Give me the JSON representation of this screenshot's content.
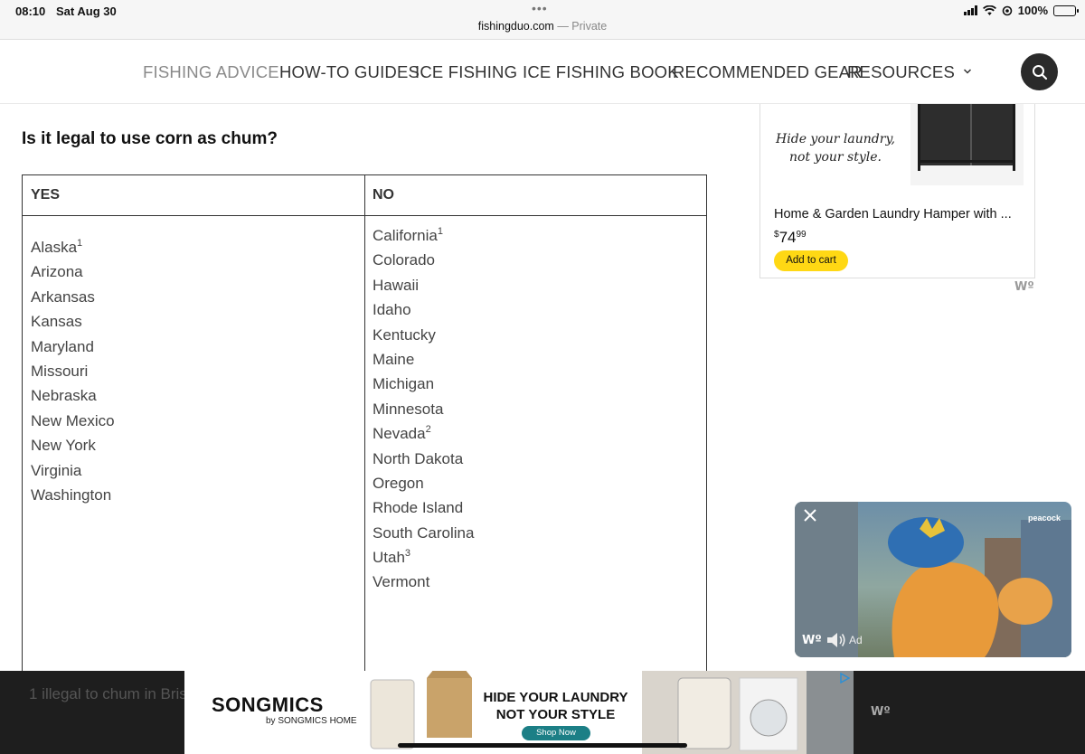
{
  "status_bar": {
    "time": "08:10",
    "date": "Sat Aug 30",
    "url": "fishingduo.com",
    "private_label": "— Private",
    "battery": "100%"
  },
  "nav": {
    "items": [
      {
        "label": "FISHING ADVICE"
      },
      {
        "label": "HOW-TO GUIDES"
      },
      {
        "label": "ICE FISHING"
      },
      {
        "label": "ICE FISHING BOOK"
      },
      {
        "label": "RECOMMENDED GEAR"
      },
      {
        "label": "RESOURCES"
      }
    ],
    "search_icon": "search-icon"
  },
  "article": {
    "question": "Is it legal to use corn as chum?",
    "table": {
      "headers": [
        "YES",
        "NO"
      ],
      "yes": [
        {
          "name": "Alaska",
          "note": "1"
        },
        {
          "name": "Arizona",
          "note": ""
        },
        {
          "name": "Arkansas",
          "note": ""
        },
        {
          "name": "Kansas",
          "note": ""
        },
        {
          "name": "Maryland",
          "note": ""
        },
        {
          "name": "Missouri",
          "note": ""
        },
        {
          "name": "Nebraska",
          "note": ""
        },
        {
          "name": "New Mexico",
          "note": ""
        },
        {
          "name": "New York",
          "note": ""
        },
        {
          "name": "Virginia",
          "note": ""
        },
        {
          "name": "Washington",
          "note": ""
        }
      ],
      "no": [
        {
          "name": "California",
          "note": "1"
        },
        {
          "name": "Colorado",
          "note": ""
        },
        {
          "name": "Hawaii",
          "note": ""
        },
        {
          "name": "Idaho",
          "note": ""
        },
        {
          "name": "Kentucky",
          "note": ""
        },
        {
          "name": "Maine",
          "note": ""
        },
        {
          "name": "Michigan",
          "note": ""
        },
        {
          "name": "Minnesota",
          "note": ""
        },
        {
          "name": "Nevada",
          "note": "2"
        },
        {
          "name": "North Dakota",
          "note": ""
        },
        {
          "name": "Oregon",
          "note": ""
        },
        {
          "name": "Rhode Island",
          "note": ""
        },
        {
          "name": "South Carolina",
          "note": ""
        },
        {
          "name": "Utah",
          "note": "3"
        },
        {
          "name": "Vermont",
          "note": ""
        }
      ]
    },
    "footnote_partial": "1 illegal to chum in Bris"
  },
  "side_ad": {
    "tagline": "Hide your laundry, not your style.",
    "title": "Home & Garden Laundry Hamper with ...",
    "price_symbol": "$",
    "price_main": "74",
    "price_cents": "99",
    "button": "Add to cart"
  },
  "video_ad": {
    "brand": "peacock",
    "ad_label": "Ad"
  },
  "banner_ad": {
    "brand": "SONGMICS",
    "brand_sub": "by SONGMICS HOME",
    "headline_1": "HIDE YOUR LAUNDRY",
    "headline_2": "NOT YOUR STYLE",
    "button": "Shop Now"
  },
  "colors": {
    "add_to_cart": "#ffd814",
    "shop_now": "#1c7f86",
    "search_button": "#2a2a2a"
  }
}
